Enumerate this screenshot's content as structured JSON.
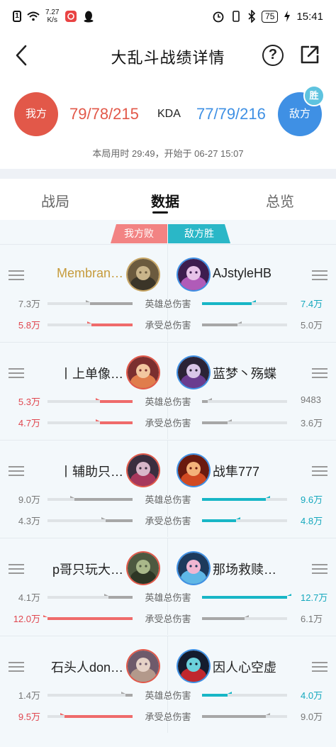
{
  "status_bar": {
    "sim_icon": "1",
    "net_speed_value": "7.27",
    "net_speed_unit": "K/s",
    "battery": "75",
    "time": "15:41"
  },
  "header": {
    "title": "大乱斗战绩详情",
    "back_icon": "chevron-left-icon",
    "help_symbol": "?",
    "share_icon": "external-link-icon"
  },
  "score": {
    "our_label": "我方",
    "enemy_label": "敌方",
    "win_badge": "胜",
    "our_kda": "79/78/215",
    "kda_label": "KDA",
    "enemy_kda": "77/79/216",
    "meta": "本局用时 29:49，开始于 06-27 15:07",
    "our_color": "#e25849",
    "enemy_color": "#3f90e4"
  },
  "tabs": [
    {
      "label": "战局",
      "active": false
    },
    {
      "label": "数据",
      "active": true
    },
    {
      "label": "总览",
      "active": false
    }
  ],
  "result_tags": {
    "our": "我方败",
    "enemy": "敌方胜"
  },
  "stat_labels": {
    "damage": "英雄总伤害",
    "taken": "承受总伤害"
  },
  "players": [
    {
      "left": {
        "name": "Membran…",
        "name_color": "#c69b3c",
        "damage": "7.3万",
        "damage_fill": 0.5,
        "damage_highlight": false,
        "taken": "5.8万",
        "taken_fill": 0.48,
        "taken_highlight": true
      },
      "right": {
        "name": "AJstyleHB",
        "damage": "7.4万",
        "damage_fill": 0.58,
        "damage_highlight": true,
        "taken": "5.0万",
        "taken_fill": 0.42,
        "taken_highlight": false
      }
    },
    {
      "left": {
        "name": "丨上单像…",
        "name_color": "#222222",
        "damage": "5.3万",
        "damage_fill": 0.38,
        "damage_highlight": true,
        "taken": "4.7万",
        "taken_fill": 0.38,
        "taken_highlight": true
      },
      "right": {
        "name": "蓝梦丶殇蝶",
        "damage": "9483",
        "damage_fill": 0.07,
        "damage_highlight": false,
        "taken": "3.6万",
        "taken_fill": 0.3,
        "taken_highlight": false
      }
    },
    {
      "left": {
        "name": "丨辅助只…",
        "name_color": "#222222",
        "damage": "9.0万",
        "damage_fill": 0.68,
        "damage_highlight": false,
        "taken": "4.3万",
        "taken_fill": 0.32,
        "taken_highlight": false
      },
      "right": {
        "name": "战隼777",
        "damage": "9.6万",
        "damage_fill": 0.75,
        "damage_highlight": true,
        "taken": "4.8万",
        "taken_fill": 0.4,
        "taken_highlight": true
      }
    },
    {
      "left": {
        "name": "p哥只玩大…",
        "name_color": "#222222",
        "damage": "4.1万",
        "damage_fill": 0.28,
        "damage_highlight": false,
        "taken": "12.0万",
        "taken_fill": 1.0,
        "taken_highlight": true
      },
      "right": {
        "name": "那场救赎…",
        "damage": "12.7万",
        "damage_fill": 1.0,
        "damage_highlight": true,
        "taken": "6.1万",
        "taken_fill": 0.5,
        "taken_highlight": false
      }
    },
    {
      "left": {
        "name": "石头人don…",
        "name_color": "#222222",
        "damage": "1.4万",
        "damage_fill": 0.08,
        "damage_highlight": false,
        "taken": "9.5万",
        "taken_fill": 0.8,
        "taken_highlight": true
      },
      "right": {
        "name": "因人心空虚",
        "damage": "4.0万",
        "damage_fill": 0.3,
        "damage_highlight": true,
        "taken": "9.0万",
        "taken_fill": 0.75,
        "taken_highlight": false
      }
    }
  ],
  "colors": {
    "highlight_red": "#e0464f",
    "highlight_teal": "#14a8bd",
    "bar_grey": "#a7a7a7"
  }
}
